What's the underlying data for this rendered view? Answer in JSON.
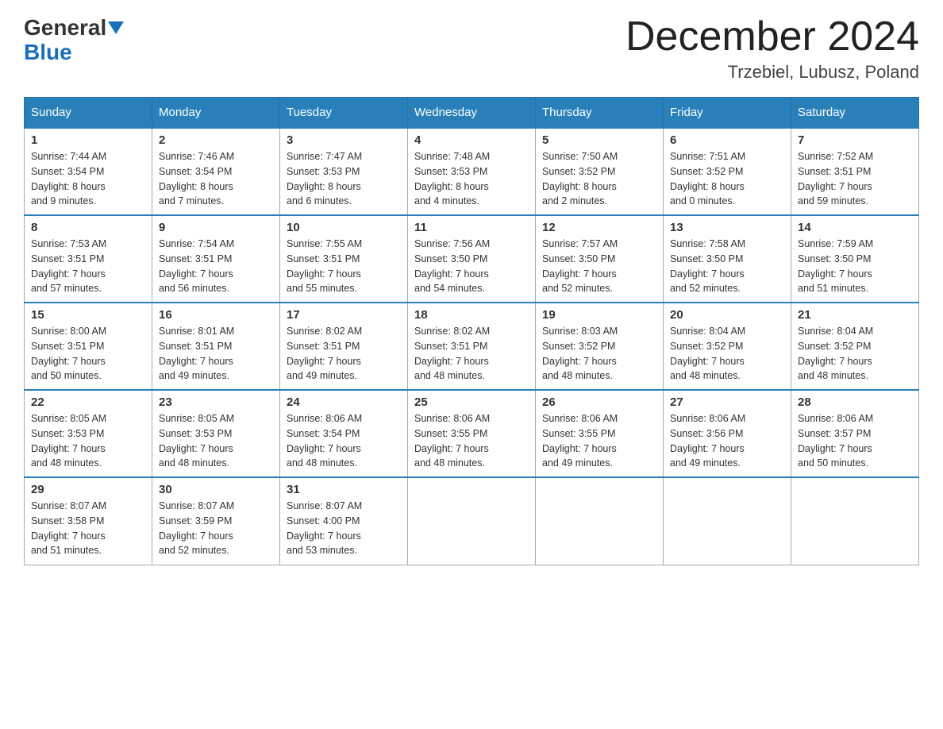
{
  "logo": {
    "general": "General",
    "blue": "Blue"
  },
  "title": "December 2024",
  "location": "Trzebiel, Lubusz, Poland",
  "days_header": [
    "Sunday",
    "Monday",
    "Tuesday",
    "Wednesday",
    "Thursday",
    "Friday",
    "Saturday"
  ],
  "weeks": [
    [
      {
        "day": "1",
        "sunrise": "7:44 AM",
        "sunset": "3:54 PM",
        "daylight": "8 hours and 9 minutes."
      },
      {
        "day": "2",
        "sunrise": "7:46 AM",
        "sunset": "3:54 PM",
        "daylight": "8 hours and 7 minutes."
      },
      {
        "day": "3",
        "sunrise": "7:47 AM",
        "sunset": "3:53 PM",
        "daylight": "8 hours and 6 minutes."
      },
      {
        "day": "4",
        "sunrise": "7:48 AM",
        "sunset": "3:53 PM",
        "daylight": "8 hours and 4 minutes."
      },
      {
        "day": "5",
        "sunrise": "7:50 AM",
        "sunset": "3:52 PM",
        "daylight": "8 hours and 2 minutes."
      },
      {
        "day": "6",
        "sunrise": "7:51 AM",
        "sunset": "3:52 PM",
        "daylight": "8 hours and 0 minutes."
      },
      {
        "day": "7",
        "sunrise": "7:52 AM",
        "sunset": "3:51 PM",
        "daylight": "7 hours and 59 minutes."
      }
    ],
    [
      {
        "day": "8",
        "sunrise": "7:53 AM",
        "sunset": "3:51 PM",
        "daylight": "7 hours and 57 minutes."
      },
      {
        "day": "9",
        "sunrise": "7:54 AM",
        "sunset": "3:51 PM",
        "daylight": "7 hours and 56 minutes."
      },
      {
        "day": "10",
        "sunrise": "7:55 AM",
        "sunset": "3:51 PM",
        "daylight": "7 hours and 55 minutes."
      },
      {
        "day": "11",
        "sunrise": "7:56 AM",
        "sunset": "3:50 PM",
        "daylight": "7 hours and 54 minutes."
      },
      {
        "day": "12",
        "sunrise": "7:57 AM",
        "sunset": "3:50 PM",
        "daylight": "7 hours and 52 minutes."
      },
      {
        "day": "13",
        "sunrise": "7:58 AM",
        "sunset": "3:50 PM",
        "daylight": "7 hours and 52 minutes."
      },
      {
        "day": "14",
        "sunrise": "7:59 AM",
        "sunset": "3:50 PM",
        "daylight": "7 hours and 51 minutes."
      }
    ],
    [
      {
        "day": "15",
        "sunrise": "8:00 AM",
        "sunset": "3:51 PM",
        "daylight": "7 hours and 50 minutes."
      },
      {
        "day": "16",
        "sunrise": "8:01 AM",
        "sunset": "3:51 PM",
        "daylight": "7 hours and 49 minutes."
      },
      {
        "day": "17",
        "sunrise": "8:02 AM",
        "sunset": "3:51 PM",
        "daylight": "7 hours and 49 minutes."
      },
      {
        "day": "18",
        "sunrise": "8:02 AM",
        "sunset": "3:51 PM",
        "daylight": "7 hours and 48 minutes."
      },
      {
        "day": "19",
        "sunrise": "8:03 AM",
        "sunset": "3:52 PM",
        "daylight": "7 hours and 48 minutes."
      },
      {
        "day": "20",
        "sunrise": "8:04 AM",
        "sunset": "3:52 PM",
        "daylight": "7 hours and 48 minutes."
      },
      {
        "day": "21",
        "sunrise": "8:04 AM",
        "sunset": "3:52 PM",
        "daylight": "7 hours and 48 minutes."
      }
    ],
    [
      {
        "day": "22",
        "sunrise": "8:05 AM",
        "sunset": "3:53 PM",
        "daylight": "7 hours and 48 minutes."
      },
      {
        "day": "23",
        "sunrise": "8:05 AM",
        "sunset": "3:53 PM",
        "daylight": "7 hours and 48 minutes."
      },
      {
        "day": "24",
        "sunrise": "8:06 AM",
        "sunset": "3:54 PM",
        "daylight": "7 hours and 48 minutes."
      },
      {
        "day": "25",
        "sunrise": "8:06 AM",
        "sunset": "3:55 PM",
        "daylight": "7 hours and 48 minutes."
      },
      {
        "day": "26",
        "sunrise": "8:06 AM",
        "sunset": "3:55 PM",
        "daylight": "7 hours and 49 minutes."
      },
      {
        "day": "27",
        "sunrise": "8:06 AM",
        "sunset": "3:56 PM",
        "daylight": "7 hours and 49 minutes."
      },
      {
        "day": "28",
        "sunrise": "8:06 AM",
        "sunset": "3:57 PM",
        "daylight": "7 hours and 50 minutes."
      }
    ],
    [
      {
        "day": "29",
        "sunrise": "8:07 AM",
        "sunset": "3:58 PM",
        "daylight": "7 hours and 51 minutes."
      },
      {
        "day": "30",
        "sunrise": "8:07 AM",
        "sunset": "3:59 PM",
        "daylight": "7 hours and 52 minutes."
      },
      {
        "day": "31",
        "sunrise": "8:07 AM",
        "sunset": "4:00 PM",
        "daylight": "7 hours and 53 minutes."
      },
      null,
      null,
      null,
      null
    ]
  ],
  "labels": {
    "sunrise": "Sunrise:",
    "sunset": "Sunset:",
    "daylight": "Daylight:"
  }
}
